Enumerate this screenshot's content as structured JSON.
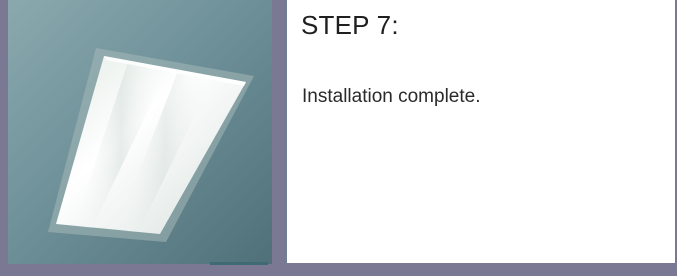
{
  "step": {
    "title": "STEP 7:",
    "description": "Installation complete."
  },
  "image": {
    "subject": "ceiling-light-fixture",
    "colors": {
      "ceiling": "#7e9ea5",
      "fixture": "#f2f6f2",
      "frame": "#7b7893"
    }
  }
}
